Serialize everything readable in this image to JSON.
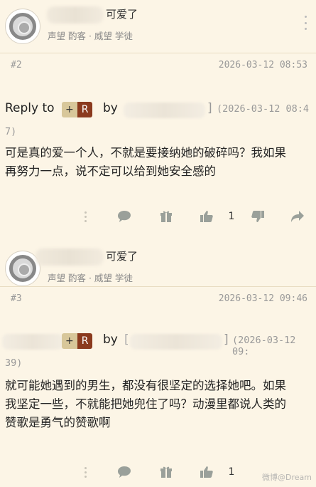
{
  "posts": [
    {
      "author_suffix": "可爱了",
      "meta": "声望 酌客 · 威望 学徒",
      "floor": "#2",
      "datetime": "2026-03-12 08:53",
      "reply_to_label": "Reply to",
      "badge_plus": "+",
      "badge_r": "R",
      "by_label": "by",
      "bracket_close": "]",
      "reply_ref_date_part1": "(2026-03-12 08:4",
      "reply_ref_date_part2": "7)",
      "body_lines": [
        "可是真的爱一个人，不就是要接纳她的破碎吗？我如果",
        "再努力一点，说不定可以给到她安全感的"
      ],
      "likes": "1"
    },
    {
      "author_suffix": "可爱了",
      "meta": "声望 酌客 · 威望 学徒",
      "floor": "#3",
      "datetime": "2026-03-12 09:46",
      "badge_plus": "+",
      "badge_r": "R",
      "by_label": "by",
      "bracket_open": "[",
      "bracket_close": "]",
      "reply_ref_date_part1": "(2026-03-12 09:",
      "reply_ref_date_part2": "39)",
      "body_lines": [
        "就可能她遇到的男生，都没有很坚定的选择她吧。如果",
        "我坚定一些，不就能把她兜住了吗？动漫里都说人类的",
        "赞歌是勇气的赞歌啊"
      ],
      "likes": "1"
    }
  ],
  "watermark": "微博@Dream",
  "colors": {
    "background": "#FCF5E6",
    "badge_plus": "#D8C79A",
    "badge_r": "#8B3A1E",
    "icon": "#9AA09A"
  },
  "icons": [
    "more-vertical-icon",
    "comment-icon",
    "gift-icon",
    "thumbs-up-icon",
    "thumbs-down-icon",
    "share-icon"
  ]
}
